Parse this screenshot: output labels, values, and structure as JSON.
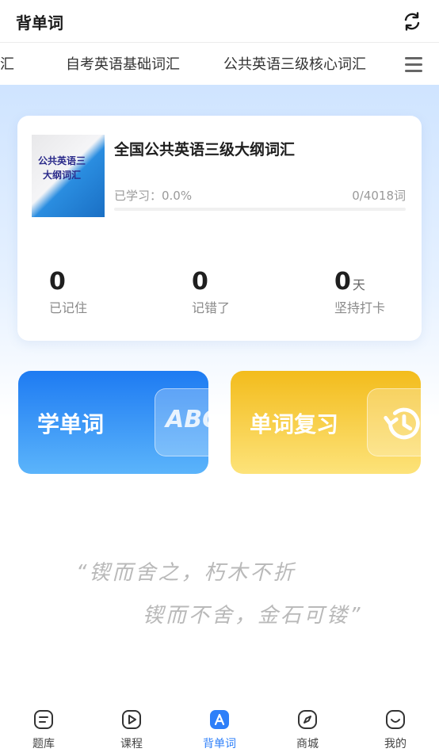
{
  "header": {
    "title": "背单词"
  },
  "tabs": [
    "词汇",
    "自考英语基础词汇",
    "公共英语三级核心词汇"
  ],
  "book": {
    "cover_line1": "公共英语三",
    "cover_line2": "大纲词汇",
    "title": "全国公共英语三级大纲词汇",
    "progress_label": "已学习：0.0%",
    "progress_count": "0/4018词",
    "progress_fraction": 0.0
  },
  "stats": [
    {
      "value": "0",
      "unit": "",
      "label": "已记住"
    },
    {
      "value": "0",
      "unit": "",
      "label": "记错了"
    },
    {
      "value": "0",
      "unit": "天",
      "label": "坚持打卡"
    }
  ],
  "actions": {
    "learn_label": "学单词",
    "learn_badge": "ABC",
    "review_label": "单词复习"
  },
  "quote": {
    "line1": "“锲而舍之，朽木不折",
    "line2": "锲而不舍，金石可镂”"
  },
  "tabbar": [
    {
      "label": "题库",
      "icon": "question-bank-icon"
    },
    {
      "label": "课程",
      "icon": "play-icon"
    },
    {
      "label": "背单词",
      "icon": "vocabulary-icon"
    },
    {
      "label": "商城",
      "icon": "compass-icon"
    },
    {
      "label": "我的",
      "icon": "smile-icon"
    }
  ],
  "colors": {
    "accent": "#2d7ff9",
    "learn_card": "#1e7bf2",
    "review_card": "#f3bc1c"
  }
}
